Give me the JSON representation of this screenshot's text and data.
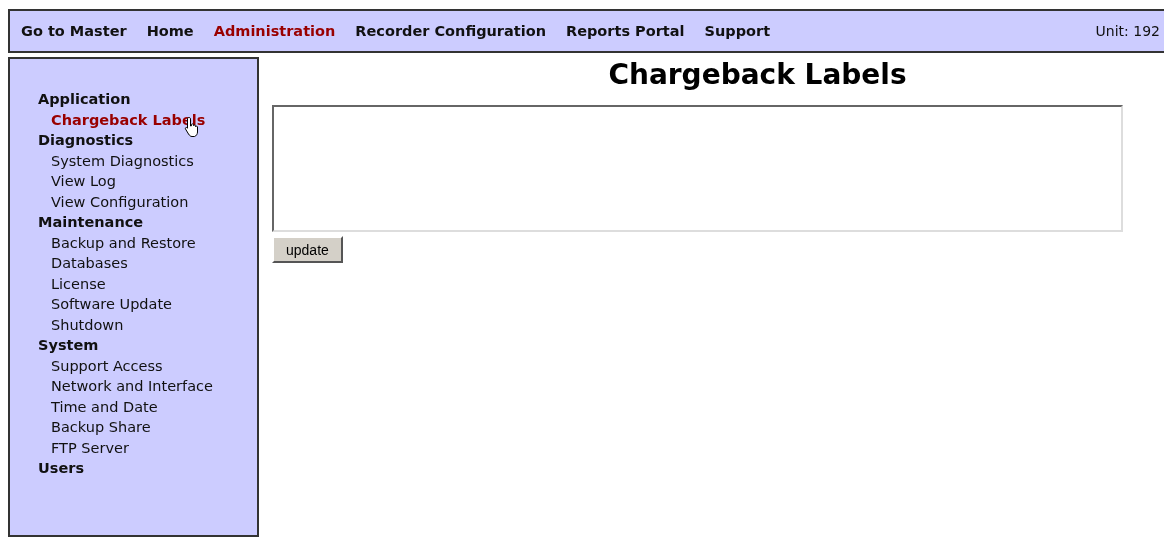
{
  "top_nav": {
    "items": [
      {
        "label": "Go to Master",
        "selected": false
      },
      {
        "label": "Home",
        "selected": false
      },
      {
        "label": "Administration",
        "selected": true
      },
      {
        "label": "Recorder Configuration",
        "selected": false
      },
      {
        "label": "Reports Portal",
        "selected": false
      },
      {
        "label": "Support",
        "selected": false
      }
    ],
    "unit": "Unit: 192"
  },
  "sidebar": {
    "groups": [
      {
        "label": "Application",
        "children": [
          {
            "label": "Chargeback Labels",
            "selected": true
          }
        ]
      },
      {
        "label": "Diagnostics",
        "children": [
          {
            "label": "System Diagnostics",
            "selected": false
          },
          {
            "label": "View Log",
            "selected": false
          },
          {
            "label": "View Configuration",
            "selected": false
          }
        ]
      },
      {
        "label": "Maintenance",
        "children": [
          {
            "label": "Backup and Restore",
            "selected": false
          },
          {
            "label": "Databases",
            "selected": false
          },
          {
            "label": "License",
            "selected": false
          },
          {
            "label": "Software Update",
            "selected": false
          },
          {
            "label": "Shutdown",
            "selected": false
          }
        ]
      },
      {
        "label": "System",
        "children": [
          {
            "label": "Support Access",
            "selected": false
          },
          {
            "label": "Network and Interface",
            "selected": false
          },
          {
            "label": "Time and Date",
            "selected": false
          },
          {
            "label": "Backup Share",
            "selected": false
          },
          {
            "label": "FTP Server",
            "selected": false
          }
        ]
      },
      {
        "label": "Users"
      }
    ]
  },
  "main": {
    "title": "Chargeback Labels",
    "button": "update"
  }
}
